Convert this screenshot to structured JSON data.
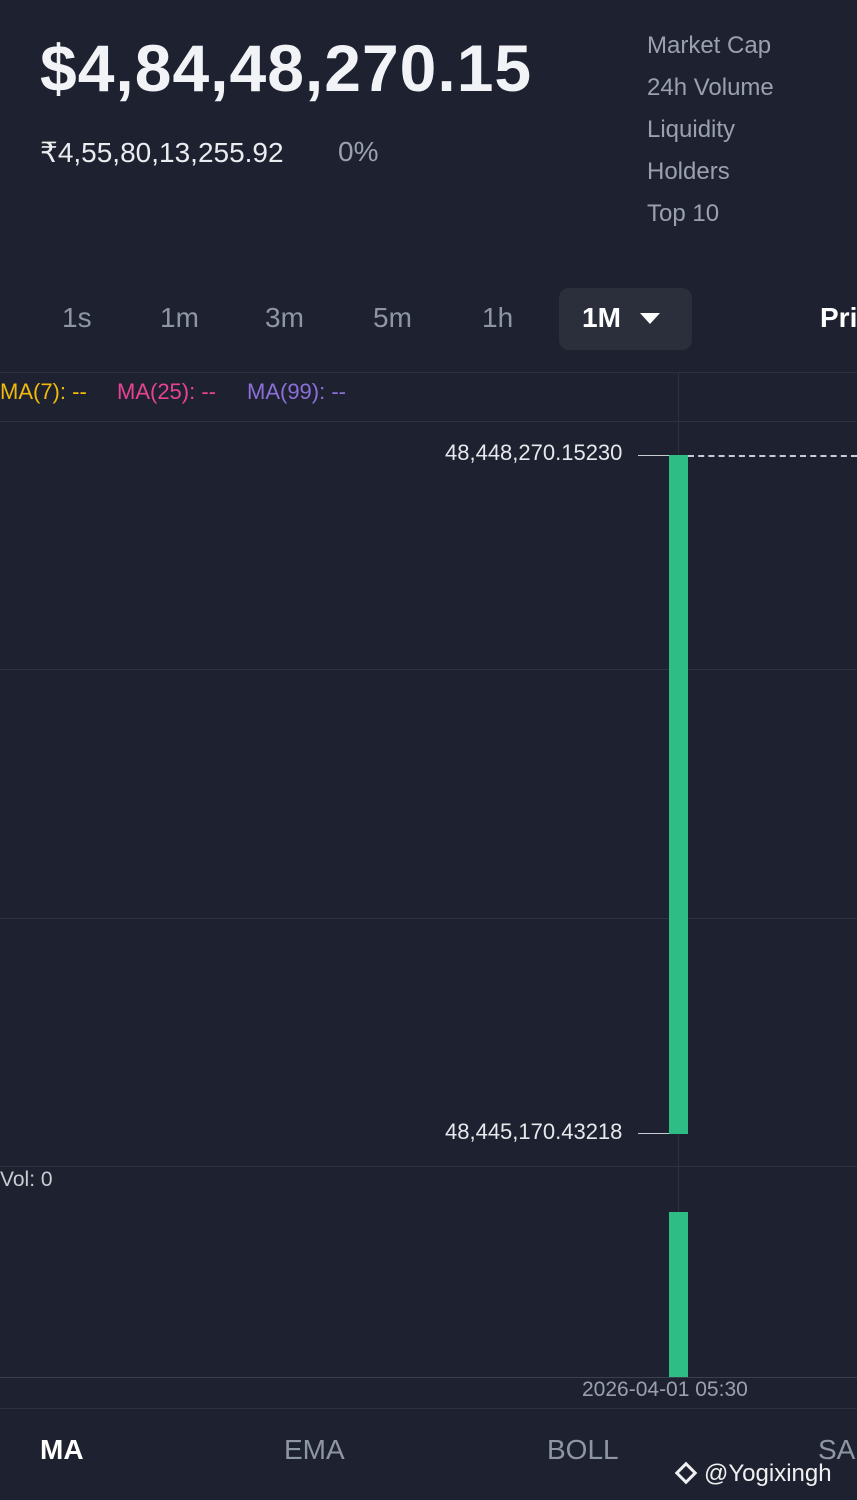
{
  "header": {
    "price": "$4,84,48,270.15",
    "fiat_price": "₹4,55,80,13,255.92",
    "change": "0%"
  },
  "stats": [
    "Market Cap",
    "24h Volume",
    "Liquidity",
    "Holders",
    "Top 10"
  ],
  "timeframes": {
    "items": [
      "1s",
      "1m",
      "3m",
      "5m",
      "1h"
    ],
    "selected": "1M",
    "extra_tab": "Pri"
  },
  "moving_averages": {
    "ma7": "MA(7): --",
    "ma25": "MA(25): --",
    "ma99": "MA(99): --",
    "colors": {
      "ma7": "#f0b90b",
      "ma25": "#e84393",
      "ma99": "#8c6fd8"
    }
  },
  "chart_data": {
    "type": "candlestick",
    "high_label": "48,448,270.15230",
    "low_label": "48,445,170.43218",
    "candles": [
      {
        "time": "2026-04-01 05:30",
        "open": 48445170.43218,
        "close": 48448270.1523,
        "high": 48448270.1523,
        "low": 48445170.43218,
        "color": "#2ebd85"
      }
    ],
    "volume_label": "Vol: 0",
    "x_label": "2026-04-01 05:30"
  },
  "indicators": {
    "items": [
      "MA",
      "EMA",
      "BOLL",
      "SA"
    ],
    "active": "MA"
  },
  "watermark": "@Yogixingh",
  "colors": {
    "background": "#1e2230",
    "up": "#2ebd85",
    "muted": "#9aa1ad"
  }
}
